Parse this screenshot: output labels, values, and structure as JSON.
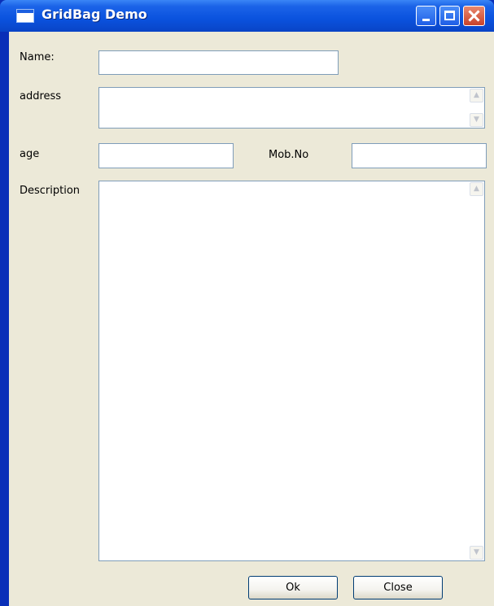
{
  "window": {
    "title": "GridBag Demo"
  },
  "form": {
    "name_label": "Name:",
    "address_label": "address",
    "age_label": "age",
    "mobno_label": "Mob.No",
    "description_label": "Description",
    "name_value": "",
    "address_value": "",
    "age_value": "",
    "mobno_value": "",
    "description_value": ""
  },
  "buttons": {
    "ok_label": "Ok",
    "close_label": "Close"
  },
  "icons": {
    "window": "window-icon",
    "minimize": "minimize-icon",
    "maximize": "maximize-icon",
    "close": "close-icon",
    "scroll_up": "chevron-up-icon",
    "scroll_down": "chevron-down-icon"
  }
}
